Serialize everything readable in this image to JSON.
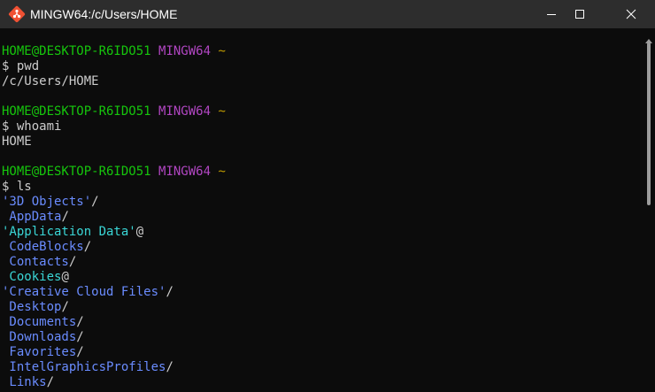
{
  "window": {
    "title": "MINGW64:/c/Users/HOME",
    "controls": {
      "minimize_icon": "minimize-icon",
      "maximize_icon": "maximize-icon",
      "close_icon": "close-icon"
    }
  },
  "colors": {
    "background": "#0c0c0c",
    "titlebar": "#2d2d2d",
    "user_host": "#16c60c",
    "mingw": "#b146c2",
    "tilde": "#c19c00",
    "text": "#cccccc",
    "directory": "#6a8cff",
    "symlink": "#3ad6d6"
  },
  "terminal": {
    "prompts": [
      {
        "user_host": "HOME@DESKTOP-R6IDO51",
        "system": "MINGW64",
        "path": "~",
        "command": "$ pwd"
      },
      {
        "user_host": "HOME@DESKTOP-R6IDO51",
        "system": "MINGW64",
        "path": "~",
        "command": "$ whoami"
      },
      {
        "user_host": "HOME@DESKTOP-R6IDO51",
        "system": "MINGW64",
        "path": "~",
        "command": "$ ls"
      }
    ],
    "outputs": {
      "pwd": "/c/Users/HOME",
      "whoami": "HOME"
    },
    "ls_entries": [
      {
        "name": "'3D Objects'",
        "suffix": "/",
        "type": "dir"
      },
      {
        "name": " AppData",
        "suffix": "/",
        "type": "dir"
      },
      {
        "name": "'Application Data'",
        "suffix": "@",
        "type": "link"
      },
      {
        "name": " CodeBlocks",
        "suffix": "/",
        "type": "dir"
      },
      {
        "name": " Contacts",
        "suffix": "/",
        "type": "dir"
      },
      {
        "name": " Cookies",
        "suffix": "@",
        "type": "link"
      },
      {
        "name": "'Creative Cloud Files'",
        "suffix": "/",
        "type": "dir"
      },
      {
        "name": " Desktop",
        "suffix": "/",
        "type": "dir"
      },
      {
        "name": " Documents",
        "suffix": "/",
        "type": "dir"
      },
      {
        "name": " Downloads",
        "suffix": "/",
        "type": "dir"
      },
      {
        "name": " Favorites",
        "suffix": "/",
        "type": "dir"
      },
      {
        "name": " IntelGraphicsProfiles",
        "suffix": "/",
        "type": "dir"
      },
      {
        "name": " Links",
        "suffix": "/",
        "type": "dir"
      }
    ]
  }
}
